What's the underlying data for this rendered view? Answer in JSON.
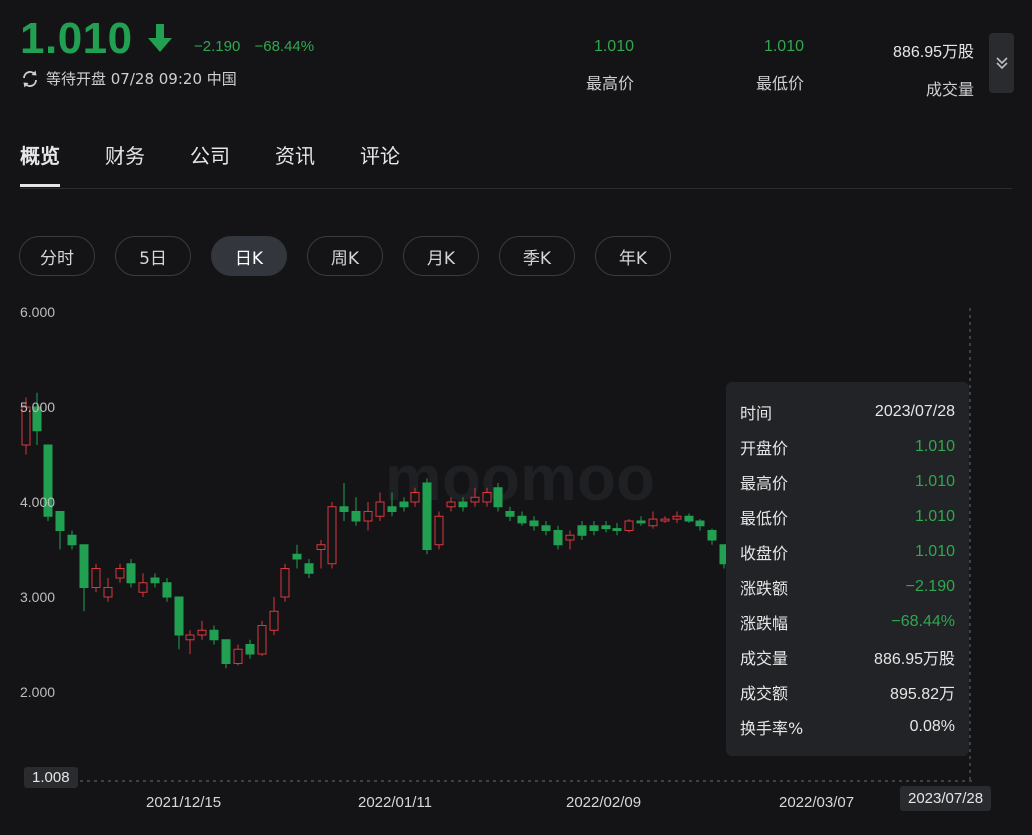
{
  "quote": {
    "price": "1.010",
    "change": "−2.190",
    "change_pct": "−68.44%",
    "status": "等待开盘 07/28 09:20 中国",
    "colors": {
      "down": "#21a052",
      "up": "#d9383e"
    }
  },
  "stats": [
    {
      "value": "1.010",
      "label": "最高价"
    },
    {
      "value": "1.010",
      "label": "最低价"
    },
    {
      "value": "886.95万股",
      "label": "成交量"
    }
  ],
  "tabs": [
    "概览",
    "财务",
    "公司",
    "资讯",
    "评论"
  ],
  "periods": [
    "分时",
    "5日",
    "日K",
    "周K",
    "月K",
    "季K",
    "年K"
  ],
  "active_period": "日K",
  "chart_data": {
    "type": "candlestick",
    "y_ticks": [
      "6.000",
      "5.000",
      "4.000",
      "3.000",
      "2.000"
    ],
    "ylim": [
      1.008,
      6.0
    ],
    "x_ticks": [
      "2021/12/15",
      "2022/01/11",
      "2022/02/09",
      "2022/03/07"
    ],
    "current_price_label": "1.008",
    "crosshair_date": "2023/07/28",
    "watermark": "moomoo"
  },
  "tooltip": [
    {
      "k": "时间",
      "v": "2023/07/28",
      "green": false
    },
    {
      "k": "开盘价",
      "v": "1.010",
      "green": true
    },
    {
      "k": "最高价",
      "v": "1.010",
      "green": true
    },
    {
      "k": "最低价",
      "v": "1.010",
      "green": true
    },
    {
      "k": "收盘价",
      "v": "1.010",
      "green": true
    },
    {
      "k": "涨跌额",
      "v": "−2.190",
      "green": true
    },
    {
      "k": "涨跌幅",
      "v": "−68.44%",
      "green": true
    },
    {
      "k": "成交量",
      "v": "886.95万股",
      "green": false
    },
    {
      "k": "成交额",
      "v": "895.82万",
      "green": false
    },
    {
      "k": "换手率%",
      "v": "0.08%",
      "green": false
    }
  ]
}
